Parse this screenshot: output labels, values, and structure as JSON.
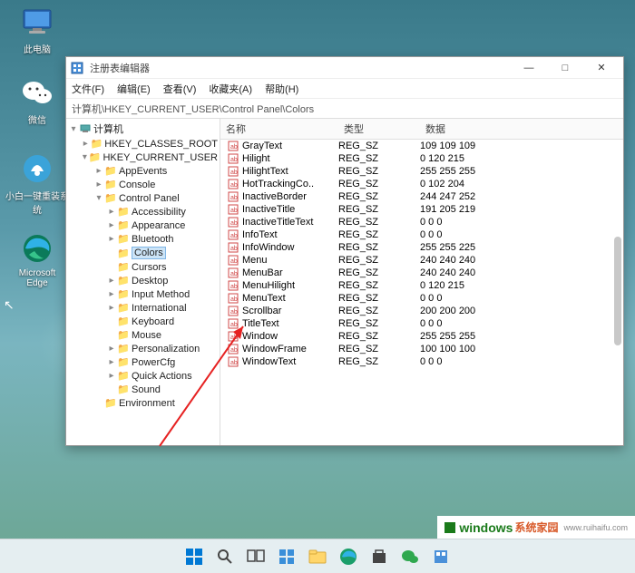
{
  "desktop_icons": [
    {
      "label": "此电脑",
      "icon": "monitor"
    },
    {
      "label": "微信",
      "icon": "wechat"
    },
    {
      "label": "小白一键重装系统",
      "icon": "mgr"
    },
    {
      "label": "Microsoft Edge",
      "icon": "edge"
    }
  ],
  "window": {
    "title": "注册表编辑器",
    "controls": {
      "minimize": "—",
      "maximize": "□",
      "close": "✕"
    }
  },
  "menu": [
    "文件(F)",
    "编辑(E)",
    "查看(V)",
    "收藏夹(A)",
    "帮助(H)"
  ],
  "path": "计算机\\HKEY_CURRENT_USER\\Control Panel\\Colors",
  "tree": {
    "root": "计算机",
    "children": [
      {
        "label": "HKEY_CLASSES_ROOT",
        "expanded": false,
        "children": []
      },
      {
        "label": "HKEY_CURRENT_USER",
        "expanded": true,
        "children": [
          {
            "label": "AppEvents",
            "expanded": false
          },
          {
            "label": "Console",
            "expanded": false
          },
          {
            "label": "Control Panel",
            "expanded": true,
            "children": [
              {
                "label": "Accessibility",
                "expanded": false
              },
              {
                "label": "Appearance",
                "expanded": false
              },
              {
                "label": "Bluetooth",
                "expanded": false
              },
              {
                "label": "Colors",
                "expanded": false,
                "selected": true
              },
              {
                "label": "Cursors",
                "expanded": false
              },
              {
                "label": "Desktop",
                "expanded": false
              },
              {
                "label": "Input Method",
                "expanded": false
              },
              {
                "label": "International",
                "expanded": false
              },
              {
                "label": "Keyboard",
                "expanded": false
              },
              {
                "label": "Mouse",
                "expanded": false
              },
              {
                "label": "Personalization",
                "expanded": false
              },
              {
                "label": "PowerCfg",
                "expanded": false
              },
              {
                "label": "Quick Actions",
                "expanded": false
              },
              {
                "label": "Sound",
                "expanded": false
              }
            ]
          },
          {
            "label": "Environment",
            "expanded": false
          }
        ]
      }
    ]
  },
  "list_header": {
    "name": "名称",
    "type": "类型",
    "data": "数据"
  },
  "values": [
    {
      "name": "GrayText",
      "type": "REG_SZ",
      "data": "109 109 109"
    },
    {
      "name": "Hilight",
      "type": "REG_SZ",
      "data": "0 120 215"
    },
    {
      "name": "HilightText",
      "type": "REG_SZ",
      "data": "255 255 255"
    },
    {
      "name": "HotTrackingCo..",
      "type": "REG_SZ",
      "data": "0 102 204"
    },
    {
      "name": "InactiveBorder",
      "type": "REG_SZ",
      "data": "244 247 252"
    },
    {
      "name": "InactiveTitle",
      "type": "REG_SZ",
      "data": "191 205 219"
    },
    {
      "name": "InactiveTitleText",
      "type": "REG_SZ",
      "data": "0 0 0"
    },
    {
      "name": "InfoText",
      "type": "REG_SZ",
      "data": "0 0 0"
    },
    {
      "name": "InfoWindow",
      "type": "REG_SZ",
      "data": "255 255 225"
    },
    {
      "name": "Menu",
      "type": "REG_SZ",
      "data": "240 240 240"
    },
    {
      "name": "MenuBar",
      "type": "REG_SZ",
      "data": "240 240 240"
    },
    {
      "name": "MenuHilight",
      "type": "REG_SZ",
      "data": "0 120 215"
    },
    {
      "name": "MenuText",
      "type": "REG_SZ",
      "data": "0 0 0"
    },
    {
      "name": "Scrollbar",
      "type": "REG_SZ",
      "data": "200 200 200"
    },
    {
      "name": "TitleText",
      "type": "REG_SZ",
      "data": "0 0 0"
    },
    {
      "name": "Window",
      "type": "REG_SZ",
      "data": "255 255 255"
    },
    {
      "name": "WindowFrame",
      "type": "REG_SZ",
      "data": "100 100 100"
    },
    {
      "name": "WindowText",
      "type": "REG_SZ",
      "data": "0 0 0"
    }
  ],
  "watermark": {
    "brand": "windows",
    "sub": "系统家园",
    "url": "www.ruihaifu.com"
  }
}
